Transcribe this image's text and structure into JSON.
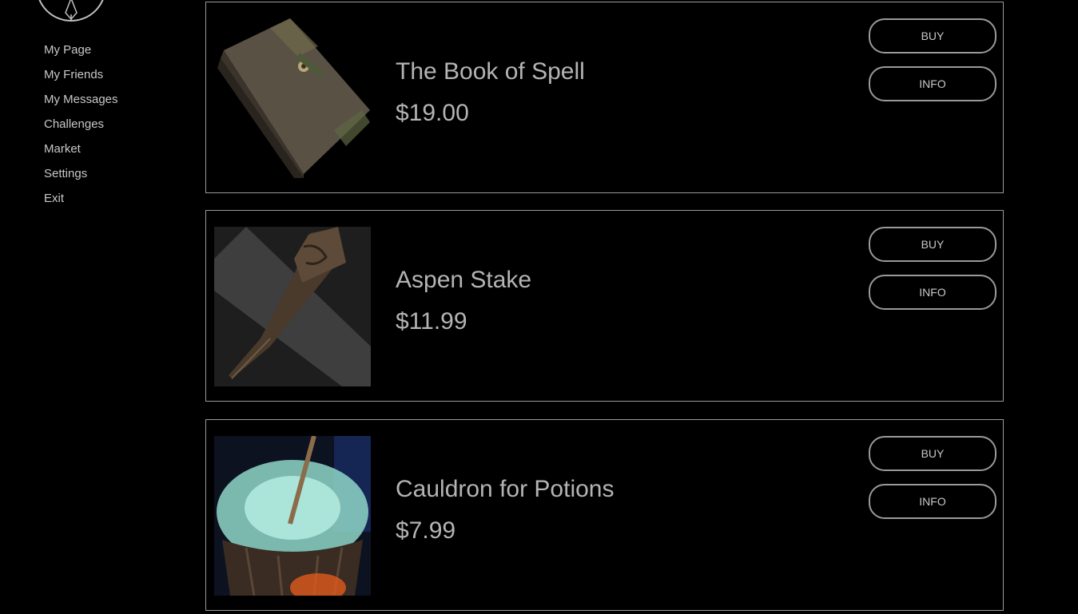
{
  "sidebar": {
    "nav": [
      "My Page",
      "My Friends",
      "My Messages",
      "Challenges",
      "Market",
      "Settings",
      "Exit"
    ]
  },
  "products": [
    {
      "name": "The Book of Spell",
      "price": "$19.00",
      "buy_label": "BUY",
      "info_label": "INFO",
      "image": "spell-book"
    },
    {
      "name": "Aspen Stake",
      "price": "$11.99",
      "buy_label": "BUY",
      "info_label": "INFO",
      "image": "wooden-stake"
    },
    {
      "name": "Cauldron for Potions",
      "price": "$7.99",
      "buy_label": "BUY",
      "info_label": "INFO",
      "image": "cauldron"
    }
  ]
}
